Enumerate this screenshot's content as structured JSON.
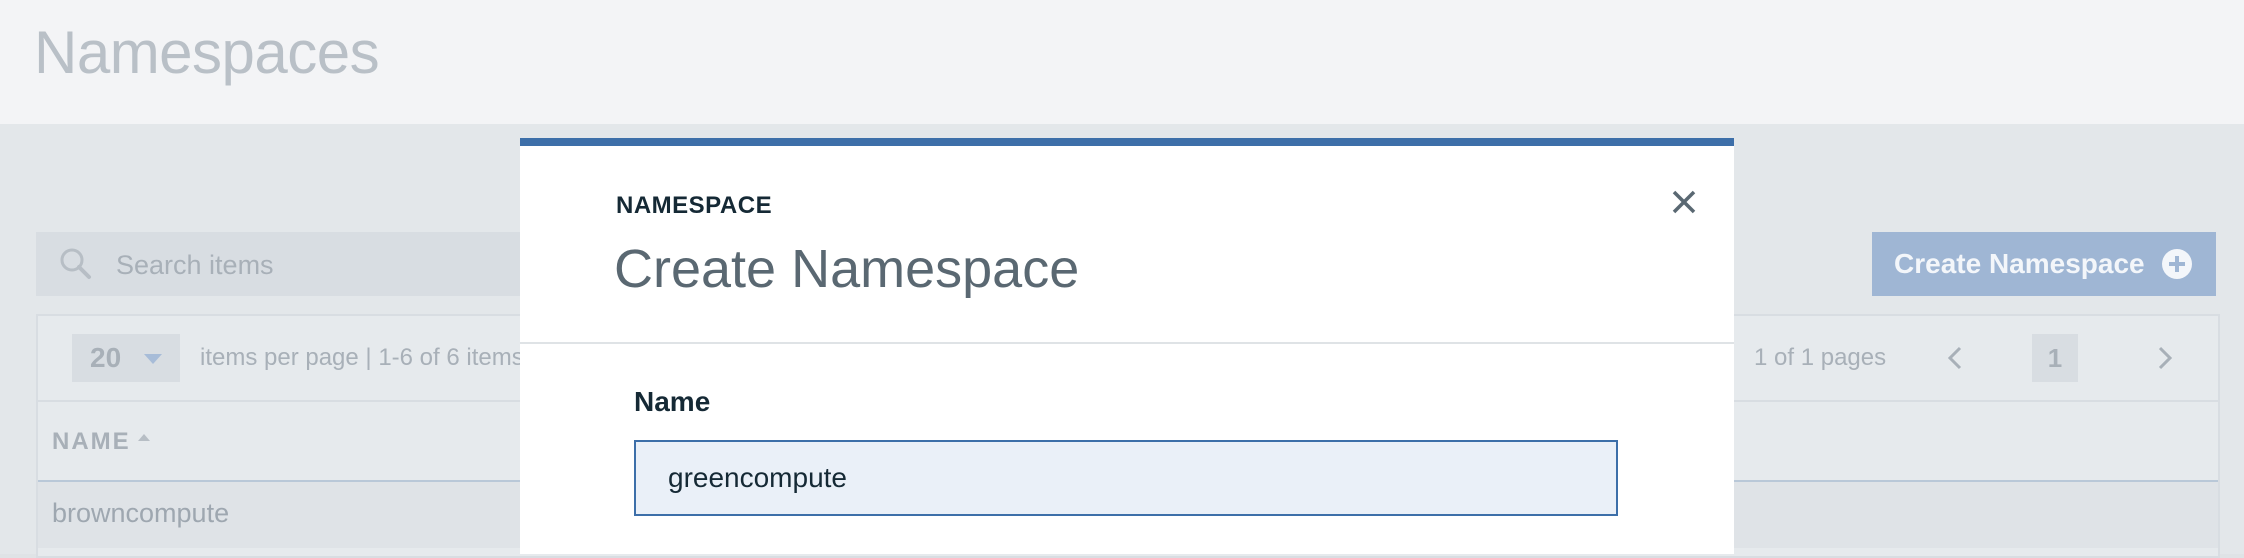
{
  "page": {
    "title": "Namespaces"
  },
  "search": {
    "placeholder": "Search items"
  },
  "create_button": {
    "label": "Create Namespace"
  },
  "pagination": {
    "page_size": "20",
    "items_per_page_text": "items per page  |  1-6 of 6 items",
    "pages_text": "1 of 1 pages",
    "current_page": "1"
  },
  "table": {
    "columns": [
      "NAME"
    ],
    "rows": [
      {
        "name": "browncompute"
      }
    ]
  },
  "modal": {
    "label": "NAMESPACE",
    "heading": "Create Namespace",
    "field_label": "Name",
    "field_value": "greencompute"
  },
  "icons": {
    "search": "search-icon",
    "add": "plus-circle-icon",
    "close": "close-icon",
    "prev": "chevron-left-icon",
    "next": "chevron-right-icon",
    "dropdown": "caret-down-icon",
    "sort": "sort-ascending-icon"
  },
  "colors": {
    "accent": "#3d6fa9",
    "button_disabled": "#9fb6d4",
    "text_dark": "#152935"
  }
}
